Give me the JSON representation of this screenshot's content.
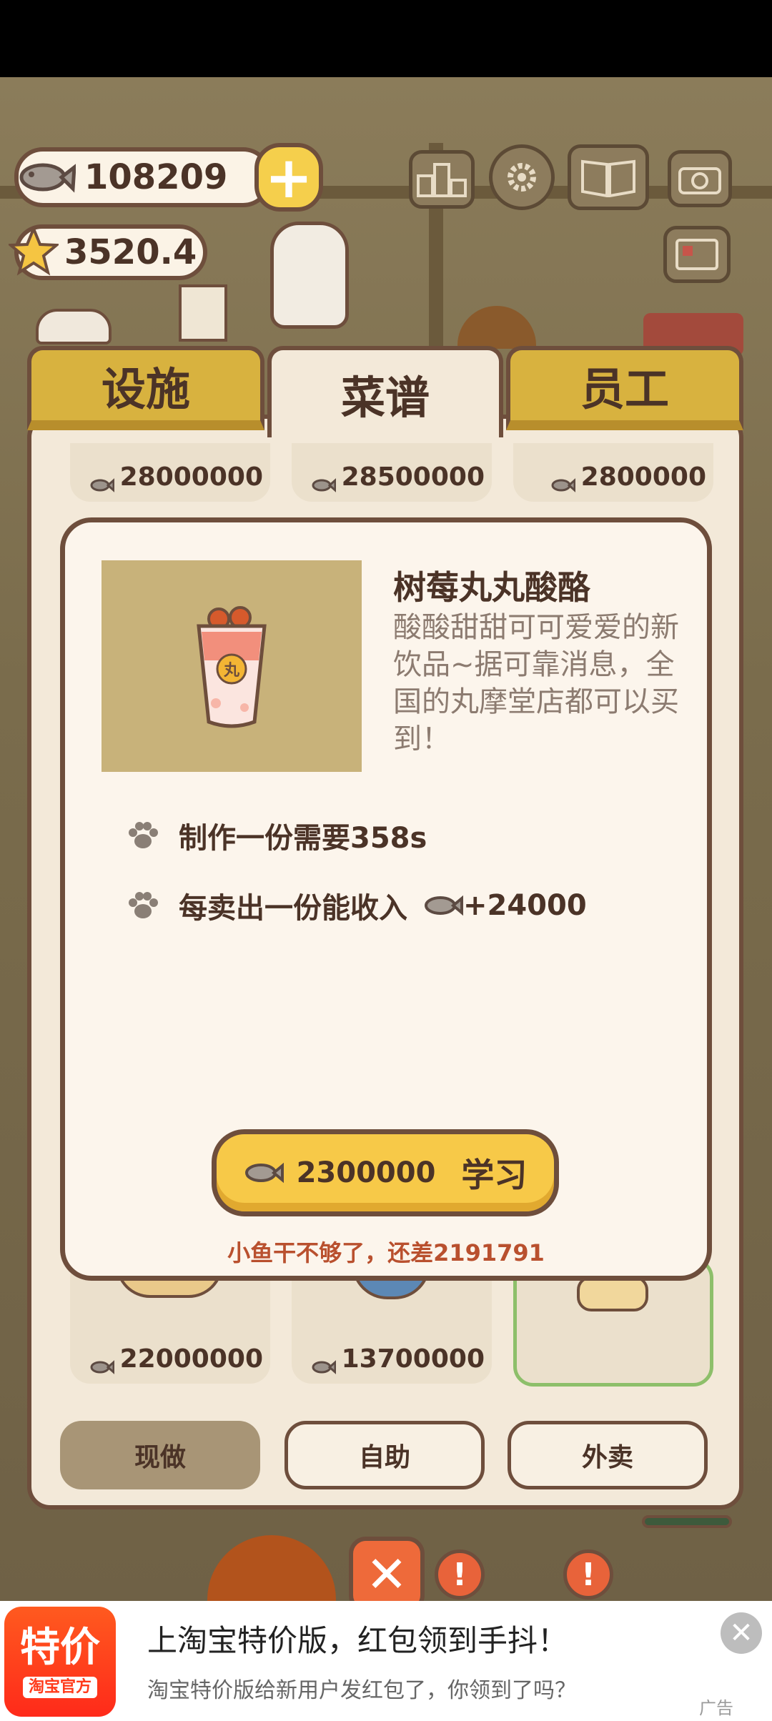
{
  "currency": {
    "fish": "108209",
    "stars": "3520.4",
    "add_icon": "plus-icon"
  },
  "tabs": [
    {
      "label": "设施",
      "active": false
    },
    {
      "label": "菜谱",
      "active": true
    },
    {
      "label": "员工",
      "active": false
    }
  ],
  "recipe_cards_top": [
    "28000000",
    "28500000",
    "2800000"
  ],
  "recipe_cards_bottom": [
    "22000000",
    "13700000"
  ],
  "detail": {
    "name": "树莓丸丸酸酪",
    "description": "酸酸甜甜可可爱爱的新饮品~据可靠消息，全国的丸摩堂店都可以买到！",
    "cup_label": "丸",
    "make_time": "制作一份需要358s",
    "income_label": "每卖出一份能收入",
    "income_value": "+24000",
    "learn_cost": "2300000",
    "learn_label": "学习",
    "warning": "小鱼干不够了，还差2191791"
  },
  "filters": [
    {
      "label": "现做",
      "active": true
    },
    {
      "label": "自助",
      "active": false
    },
    {
      "label": "外卖",
      "active": false
    }
  ],
  "ad": {
    "logo_main": "特价",
    "logo_sub": "淘宝官方",
    "title": "上淘宝特价版，红包领到手抖！",
    "subtitle": "淘宝特价版给新用户发红包了，你领到了吗？",
    "tag": "广告"
  }
}
